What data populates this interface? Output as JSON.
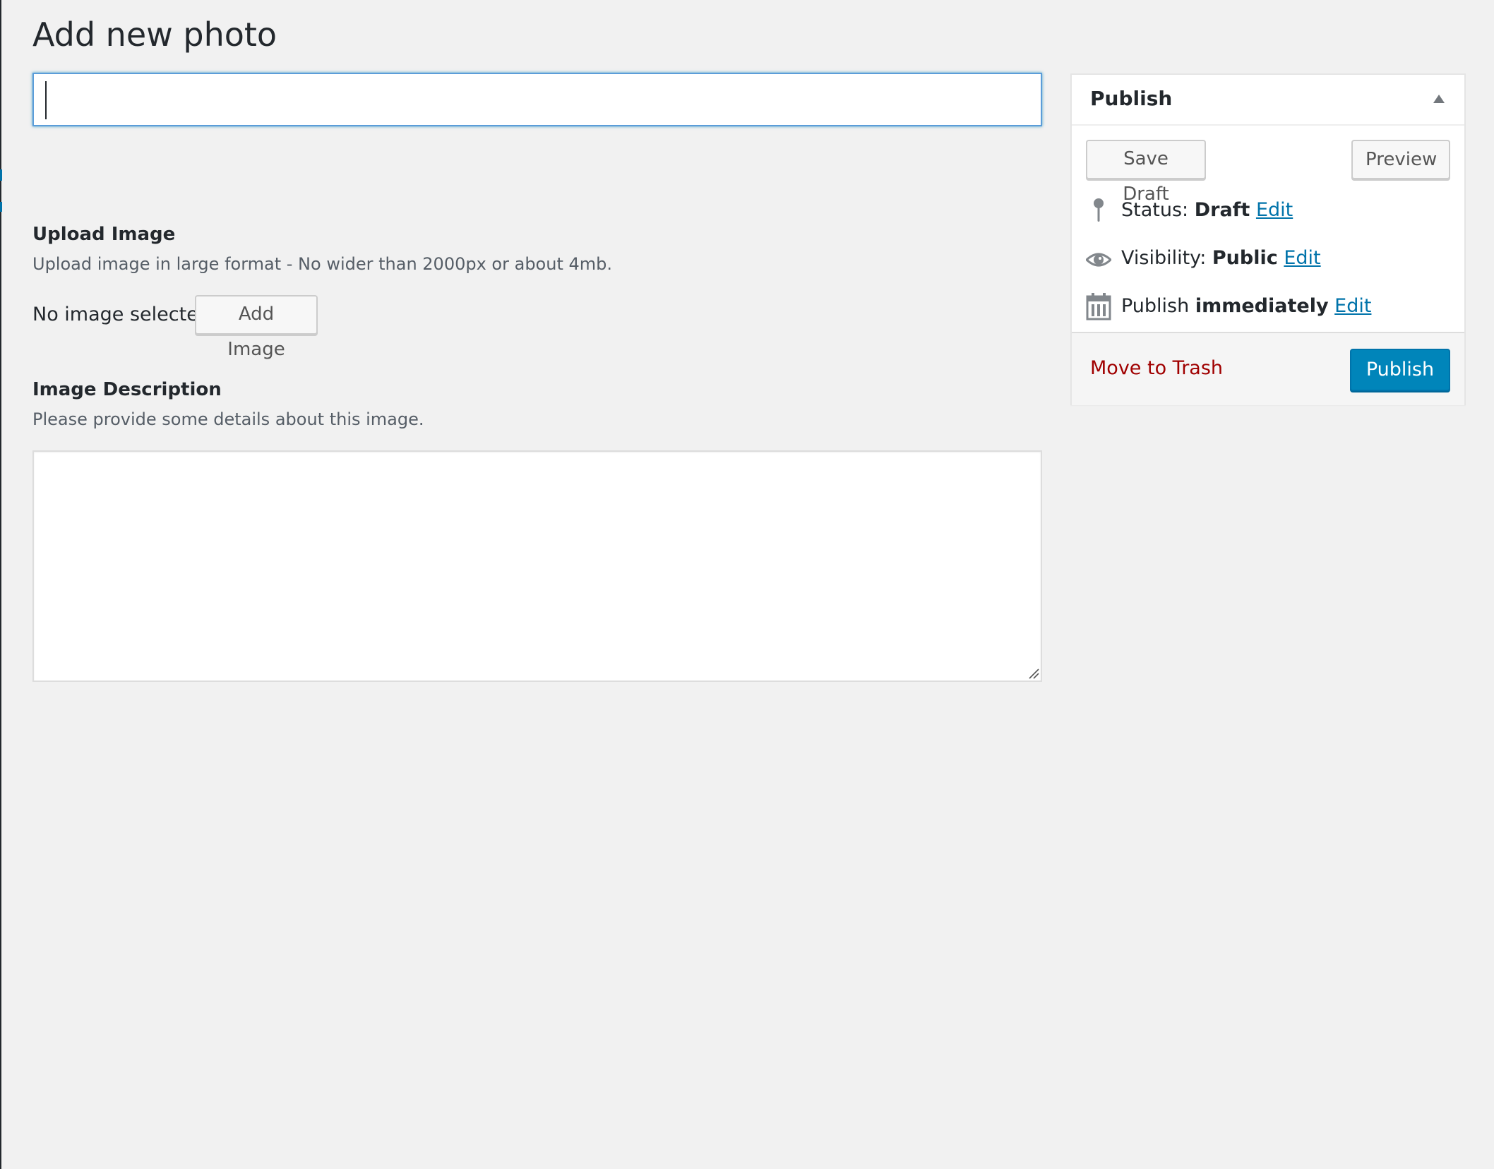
{
  "page": {
    "title": "Add new photo"
  },
  "title_input": {
    "value": "",
    "placeholder": ""
  },
  "upload_section": {
    "heading": "Upload Image",
    "description": "Upload image in large format - No wider than 2000px or about 4mb.",
    "no_image_text": "No image selected",
    "add_image_label": "Add Image"
  },
  "description_section": {
    "heading": "Image Description",
    "description": "Please provide some details about this image.",
    "textarea_value": ""
  },
  "publish_box": {
    "title": "Publish",
    "save_draft_label": "Save Draft",
    "preview_label": "Preview",
    "status": {
      "icon": "pin-icon",
      "label": "Status:",
      "value": "Draft",
      "edit_label": "Edit"
    },
    "visibility": {
      "icon": "eye-icon",
      "label": "Visibility:",
      "value": "Public",
      "edit_label": "Edit"
    },
    "schedule": {
      "icon": "calendar-icon",
      "label": "Publish",
      "value": "immediately",
      "edit_label": "Edit"
    },
    "trash_label": "Move to Trash",
    "publish_label": "Publish"
  },
  "colors": {
    "background": "#f1f1f1",
    "link": "#0073aa",
    "primary_button": "#0085ba",
    "trash": "#a00000",
    "focus_border": "#5b9dd9"
  }
}
